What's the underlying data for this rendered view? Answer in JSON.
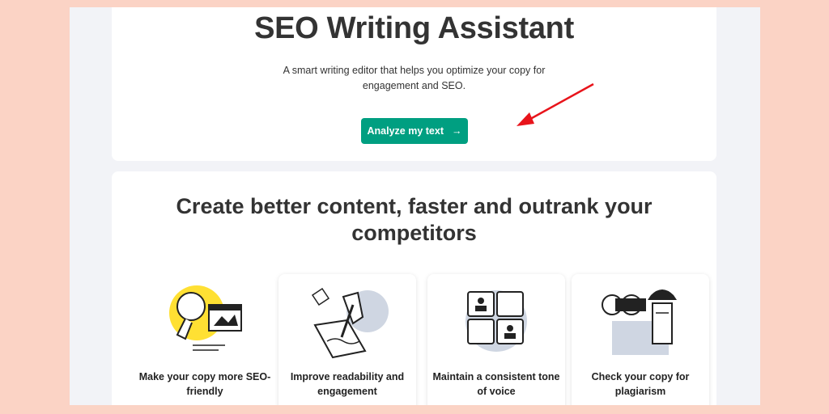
{
  "hero": {
    "title": "SEO Writing Assistant",
    "subtitle": "A smart writing editor that helps you optimize your copy for engagement and SEO.",
    "cta_label": "Analyze my text",
    "cta_icon": "arrow-right-icon"
  },
  "features": {
    "title": "Create better content, faster and outrank your competitors",
    "items": [
      {
        "label": "Make your copy more SEO-friendly",
        "icon": "lightbulb-illustration"
      },
      {
        "label": "Improve readability and engagement",
        "icon": "writing-hand-illustration"
      },
      {
        "label": "Maintain a consistent tone of voice",
        "icon": "puzzle-illustration"
      },
      {
        "label": "Check your copy for plagiarism",
        "icon": "binoculars-illustration"
      }
    ]
  },
  "colors": {
    "accent": "#009f81",
    "annotation": "#e8141b",
    "frame": "#fbd3c5"
  }
}
